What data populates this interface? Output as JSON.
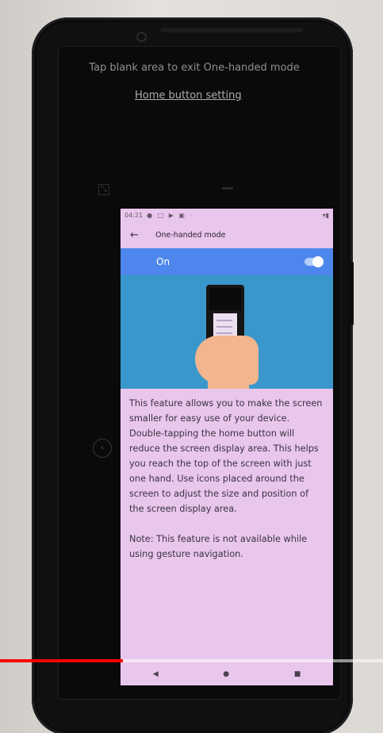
{
  "outer_screen": {
    "hint": "Tap blank area to exit One-handed mode",
    "home_button_setting": "Home button setting",
    "icons": [
      "resize-icon",
      "move-handle-icon",
      "switch-side-icon",
      "camera-icon"
    ]
  },
  "mini_screen": {
    "status_bar": {
      "time": "04:21",
      "icons": "● □ ▶ ▣ ·",
      "right": "▾▮"
    },
    "app_bar": {
      "back_icon": "back-arrow-icon",
      "title": "One-handed mode"
    },
    "toggle_row": {
      "label": "On",
      "state": true,
      "accent_color": "#4d86ec"
    },
    "description": "This feature allows you to make the screen smaller for easy use of your device. Double-tapping the home button will reduce the screen display area. This helps you reach the top of the screen with just one hand. Use icons placed around the screen to adjust the size and position of the screen display area.",
    "note": "Note: This feature is not available while using gesture navigation.",
    "nav": {
      "back": "◀",
      "home": "●",
      "recents": "■"
    },
    "background_color": "#e9c6ec",
    "illustration_color": "#3a97cc"
  },
  "video_progress": {
    "fraction": 0.32,
    "color": "#ff0000"
  }
}
